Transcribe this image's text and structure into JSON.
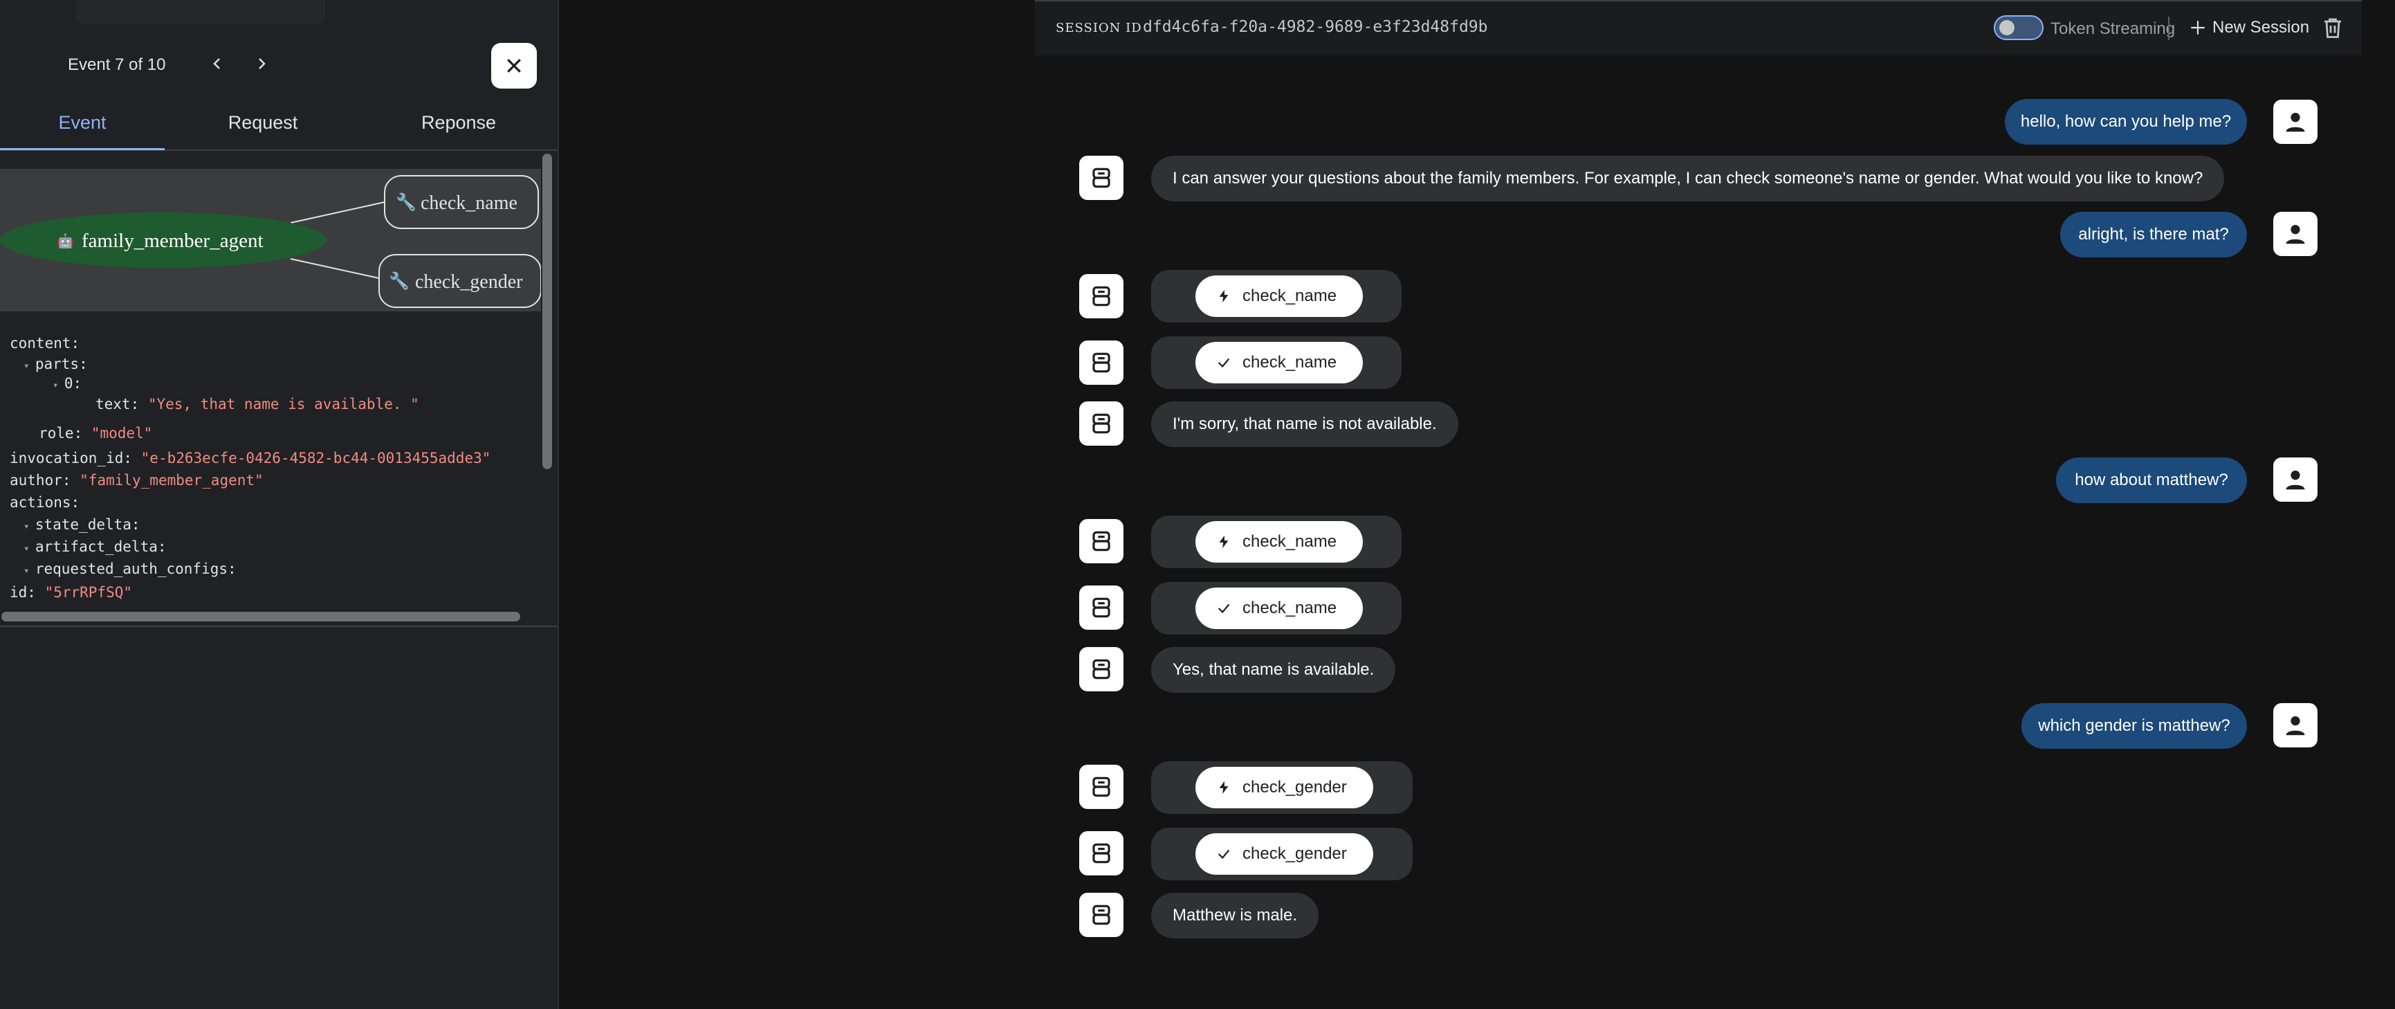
{
  "event_panel": {
    "counter": "Event 7 of 10",
    "tabs": [
      {
        "label": "Event",
        "active": true
      },
      {
        "label": "Request",
        "active": false
      },
      {
        "label": "Reponse",
        "active": false
      }
    ],
    "graph": {
      "agent_node": "family_member_agent",
      "agent_icon": "robot-emoji",
      "tool_nodes": [
        "check_name",
        "check_gender"
      ],
      "tool_icon": "wrench-emoji",
      "agent_color": "#1e5b2e"
    },
    "code_lines": [
      {
        "key": "content:",
        "value": ""
      },
      {
        "key": "parts:",
        "value": ""
      },
      {
        "key": "0:",
        "value": ""
      },
      {
        "key": "text: ",
        "value": "\"Yes, that name is available. \""
      },
      {
        "key": "role: ",
        "value": "\"model\""
      },
      {
        "key": "invocation_id: ",
        "value": "\"e-b263ecfe-0426-4582-bc44-0013455adde3\""
      },
      {
        "key": "author: ",
        "value": "\"family_member_agent\""
      },
      {
        "key": "actions:",
        "value": ""
      },
      {
        "key": "state_delta:",
        "value": ""
      },
      {
        "key": "artifact_delta:",
        "value": ""
      },
      {
        "key": "requested_auth_configs:",
        "value": ""
      },
      {
        "key": "id: ",
        "value": "\"5rrRPfSQ\""
      }
    ]
  },
  "chat_header": {
    "session_label": "SESSION ID",
    "session_id": "dfd4c6fa-f20a-4982-9689-e3f23d48fd9b",
    "streaming_label": "Token Streaming",
    "streaming_on": false,
    "new_session_label": "New Session"
  },
  "messages": [
    {
      "role": "user",
      "text": "hello, how can you help me?"
    },
    {
      "role": "bot",
      "text": "I can answer your questions about the family members. For example, I can check someone's name or gender. What would you like to know?"
    },
    {
      "role": "user",
      "text": "alright, is there mat?"
    },
    {
      "role": "tool_call",
      "text": "check_name",
      "icon": "bolt-icon"
    },
    {
      "role": "tool_result",
      "text": "check_name",
      "icon": "check-icon"
    },
    {
      "role": "bot",
      "text": "I'm sorry, that name is not available."
    },
    {
      "role": "user",
      "text": "how about matthew?"
    },
    {
      "role": "tool_call",
      "text": "check_name",
      "icon": "bolt-icon"
    },
    {
      "role": "tool_result",
      "text": "check_name",
      "icon": "check-icon"
    },
    {
      "role": "bot",
      "text": "Yes, that name is available."
    },
    {
      "role": "user",
      "text": "which gender is matthew?"
    },
    {
      "role": "tool_call",
      "text": "check_gender",
      "icon": "bolt-icon"
    },
    {
      "role": "tool_result",
      "text": "check_gender",
      "icon": "check-icon"
    },
    {
      "role": "bot",
      "text": "Matthew is male."
    }
  ],
  "colors": {
    "user_bubble": "#1c4a7a",
    "bot_bubble": "#303134",
    "accent": "#8ab4f8",
    "code_string": "#f28b82"
  }
}
